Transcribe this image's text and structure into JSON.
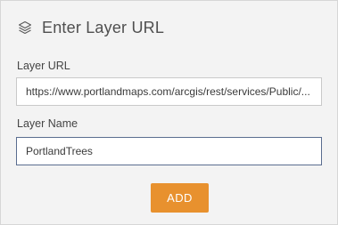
{
  "header": {
    "icon": "layers-icon",
    "title": "Enter Layer URL"
  },
  "form": {
    "layer_url": {
      "label": "Layer URL",
      "value": "https://www.portlandmaps.com/arcgis/rest/services/Public/..."
    },
    "layer_name": {
      "label": "Layer Name",
      "value": "PortlandTrees"
    },
    "add_button": {
      "label": "ADD",
      "color": "#e8912e"
    }
  }
}
